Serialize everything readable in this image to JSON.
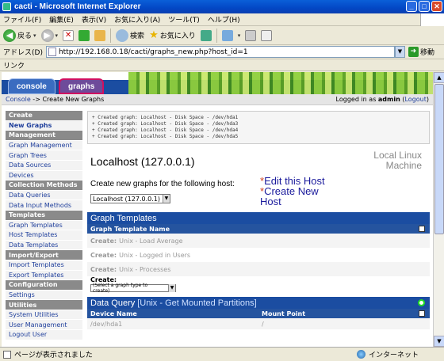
{
  "window": {
    "title": "cacti - Microsoft Internet Explorer"
  },
  "menu": [
    "ファイル(F)",
    "編集(E)",
    "表示(V)",
    "お気に入り(A)",
    "ツール(T)",
    "ヘルプ(H)"
  ],
  "toolbar": {
    "back": "戻る",
    "search": "検索",
    "favorites": "お気に入り"
  },
  "address": {
    "label": "アドレス(D)",
    "url": "http://192.168.0.18/cacti/graphs_new.php?host_id=1",
    "go": "移動"
  },
  "links": {
    "label": "リンク"
  },
  "tabs": {
    "console": "console",
    "graphs": "graphs"
  },
  "crumb": {
    "console": "Console",
    "sep": " -> ",
    "current": "Create New Graphs",
    "logged_prefix": "Logged in as ",
    "user": "admin",
    "logout": "Logout"
  },
  "sidebar": [
    {
      "label": "Create",
      "type": "header"
    },
    {
      "label": "New Graphs",
      "type": "item",
      "active": true
    },
    {
      "label": "Management",
      "type": "header"
    },
    {
      "label": "Graph Management",
      "type": "item"
    },
    {
      "label": "Graph Trees",
      "type": "item"
    },
    {
      "label": "Data Sources",
      "type": "item"
    },
    {
      "label": "Devices",
      "type": "item"
    },
    {
      "label": "Collection Methods",
      "type": "header"
    },
    {
      "label": "Data Queries",
      "type": "item"
    },
    {
      "label": "Data Input Methods",
      "type": "item"
    },
    {
      "label": "Templates",
      "type": "header"
    },
    {
      "label": "Graph Templates",
      "type": "item"
    },
    {
      "label": "Host Templates",
      "type": "item"
    },
    {
      "label": "Data Templates",
      "type": "item"
    },
    {
      "label": "Import/Export",
      "type": "header"
    },
    {
      "label": "Import Templates",
      "type": "item"
    },
    {
      "label": "Export Templates",
      "type": "item"
    },
    {
      "label": "Configuration",
      "type": "header"
    },
    {
      "label": "Settings",
      "type": "item"
    },
    {
      "label": "Utilities",
      "type": "header"
    },
    {
      "label": "System Utilities",
      "type": "item"
    },
    {
      "label": "User Management",
      "type": "item"
    },
    {
      "label": "Logout User",
      "type": "item"
    }
  ],
  "messages": [
    "+ Created graph: Localhost - Disk Space - /dev/hda1",
    "+ Created graph: Localhost - Disk Space - /dev/hda3",
    "+ Created graph: Localhost - Disk Space - /dev/hda4",
    "+ Created graph: Localhost - Disk Space - /dev/hda5"
  ],
  "host": {
    "title": "Localhost (127.0.0.1)",
    "type_line1": "Local Linux",
    "type_line2": "Machine"
  },
  "create": {
    "label": "Create new graphs for the following host:",
    "selected": "Localhost (127.0.0.1)",
    "edit_link": "Edit this Host",
    "create_link": "Create New",
    "create_link2": "Host"
  },
  "graph_templates": {
    "title": "Graph Templates",
    "col": "Graph Template Name",
    "rows": [
      {
        "prefix": "Create:",
        "name": "Unix - Load Average"
      },
      {
        "prefix": "Create:",
        "name": "Unix - Logged in Users"
      },
      {
        "prefix": "Create:",
        "name": "Unix - Processes"
      }
    ],
    "create_label": "Create:",
    "select_placeholder": "(Select a graph type to create)"
  },
  "data_query": {
    "title": "Data Query",
    "query": "[Unix - Get Mounted Partitions]",
    "col1": "Device Name",
    "col2": "Mount Point",
    "first_device": "/dev/hda1",
    "first_mount": "/"
  },
  "status": {
    "text": "ページが表示されました",
    "zone": "インターネット"
  }
}
